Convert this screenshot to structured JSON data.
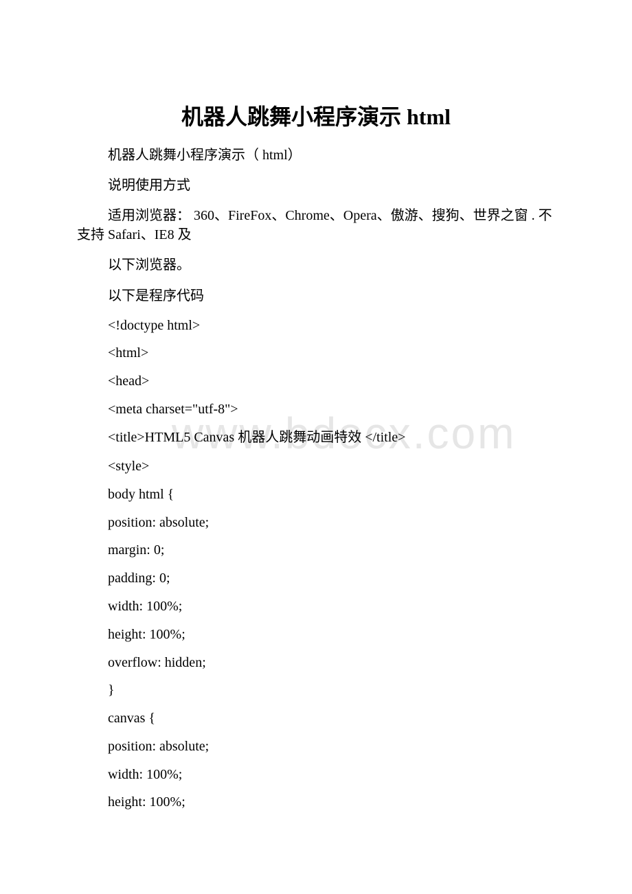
{
  "document": {
    "title": "机器人跳舞小程序演示 html",
    "watermark": "www.bdocx.com",
    "paragraphs": [
      "机器人跳舞小程序演示（ html）",
      "说明使用方式",
      "适用浏览器： 360、FireFox、Chrome、Opera、傲游、搜狗、世界之窗 . 不支持 Safari、IE8 及",
      "以下浏览器。",
      "以下是程序代码"
    ],
    "code_lines": [
      "<!doctype html>",
      "<html>",
      "<head>",
      "<meta charset=\"utf-8\">",
      "<title>HTML5 Canvas 机器人跳舞动画特效 </title>",
      "<style>",
      "body html {",
      "position: absolute;",
      "margin: 0;",
      "padding: 0;",
      "width: 100%;",
      "height: 100%;",
      "overflow: hidden;",
      "}",
      "canvas {",
      "position: absolute;",
      "width: 100%;",
      "height: 100%;"
    ]
  }
}
